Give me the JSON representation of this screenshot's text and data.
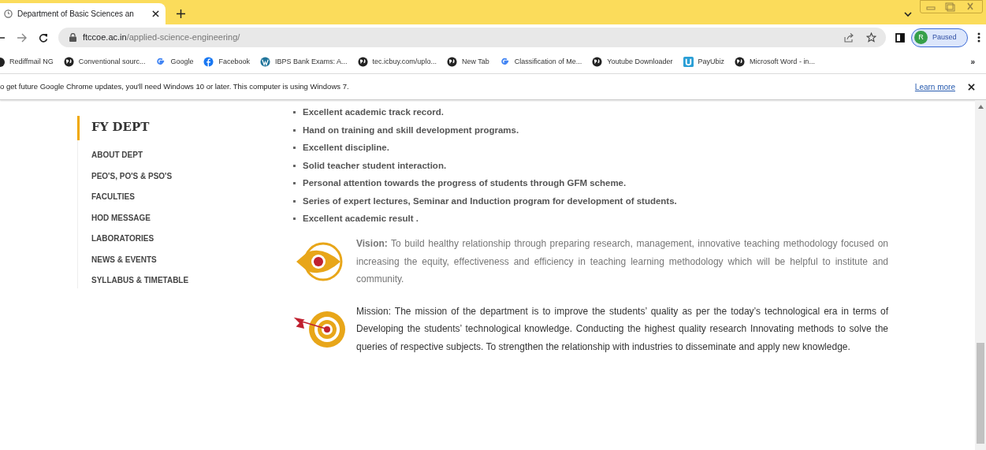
{
  "tab": {
    "title": "Department of Basic Sciences an",
    "selected": true
  },
  "address": {
    "domain": "ftccoe.ac.in",
    "path": "/applied-science-engineering/"
  },
  "profile": {
    "initial": "R",
    "status": "Paused"
  },
  "bookmarks": [
    {
      "label": "Rediffmail NG",
      "kind": "partial"
    },
    {
      "label": "Conventional sourc...",
      "kind": "globe"
    },
    {
      "label": "Google",
      "kind": "google"
    },
    {
      "label": "Facebook",
      "kind": "facebook"
    },
    {
      "label": "IBPS Bank Exams: A...",
      "kind": "wordpress"
    },
    {
      "label": "tec.icbuy.com/uplo...",
      "kind": "globe"
    },
    {
      "label": "New Tab",
      "kind": "globe"
    },
    {
      "label": "Classification of Me...",
      "kind": "google"
    },
    {
      "label": "Youtube Downloader",
      "kind": "globe"
    },
    {
      "label": "PayUbiz",
      "kind": "payubiz"
    },
    {
      "label": "Microsoft Word - in...",
      "kind": "globe"
    }
  ],
  "bookmarks_more": "»",
  "infobar": {
    "message": "o get future Google Chrome updates, you'll need Windows 10 or later. This computer is using Windows 7.",
    "link": "Learn more"
  },
  "sidebar": {
    "title": "FY DEPT",
    "items": [
      "ABOUT DEPT",
      "PEO'S, PO'S & PSO'S",
      "FACULTIES",
      "HOD MESSAGE",
      "LABORATORIES",
      "NEWS & EVENTS",
      "SYLLABUS & TIMETABLE"
    ]
  },
  "bullets": [
    "Excellent academic track record.",
    "Hand on training and skill development programs.",
    "Excellent discipline.",
    "Solid teacher student interaction.",
    "Personal attention towards the progress of students through GFM scheme.",
    "Series of expert  lectures, Seminar and Induction program for development of students.",
    "Excellent academic result ."
  ],
  "statements": [
    {
      "kind": "vision",
      "text": "**Vision:** To build healthy relationship through preparing research, management, innovative teaching methodology focused on increasing the equity, effectiveness and efficiency in teaching learning methodology which will be helpful to institute and community."
    },
    {
      "kind": "mission",
      "text": "Mission: The mission of the department is to improve the students’ quality as per the today’s technological era in terms of Developing the students’ technological knowledge. Conducting the highest quality research Innovating methods to solve the queries of respective subjects. To strengthen the relationship with industries to disseminate and apply new knowledge."
    }
  ]
}
